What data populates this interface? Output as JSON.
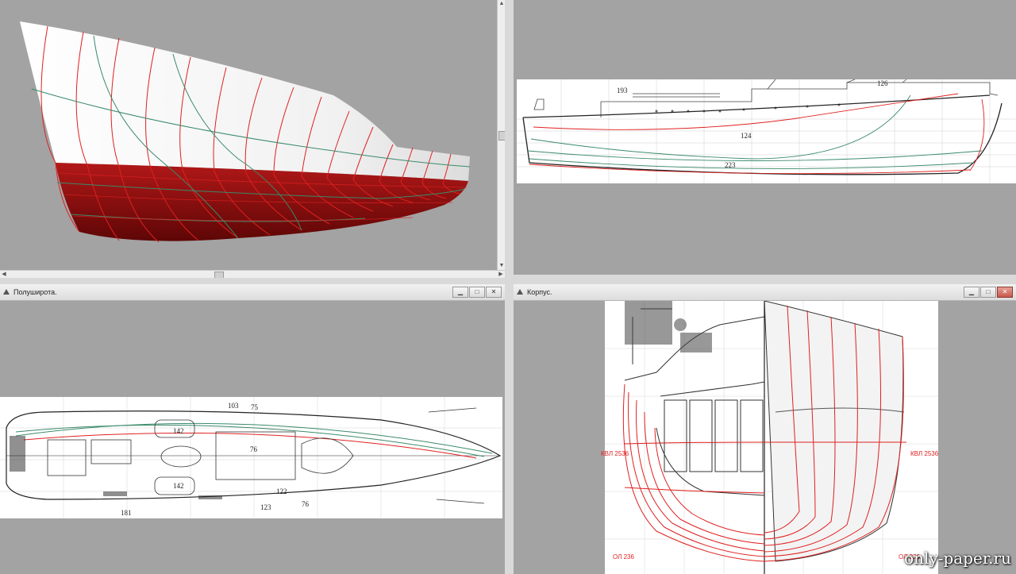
{
  "windows": {
    "perspective": {
      "title": ""
    },
    "side": {
      "title": "",
      "labels": [
        "193",
        "126",
        "124",
        "223"
      ]
    },
    "halfbreadth": {
      "title": "Полуширота.",
      "labels": [
        "103",
        "75",
        "142",
        "76",
        "142",
        "122",
        "123",
        "76",
        "181"
      ]
    },
    "body": {
      "title": "Корпус.",
      "labels": {
        "kvl_left": "КВЛ 2536",
        "kvl_right": "КВЛ 2536",
        "ol_left": "ОЛ 236",
        "ol_right": "ОЛ 236"
      }
    }
  },
  "window_buttons": {
    "minimize": "▁",
    "maximize": "□",
    "close": "✕"
  },
  "watermark": "only-paper.ru",
  "colors": {
    "hull_red": "#8b0e0e",
    "line_red": "#e02020",
    "line_green": "#3a8a6a",
    "chrome": "#d9d9d9"
  }
}
